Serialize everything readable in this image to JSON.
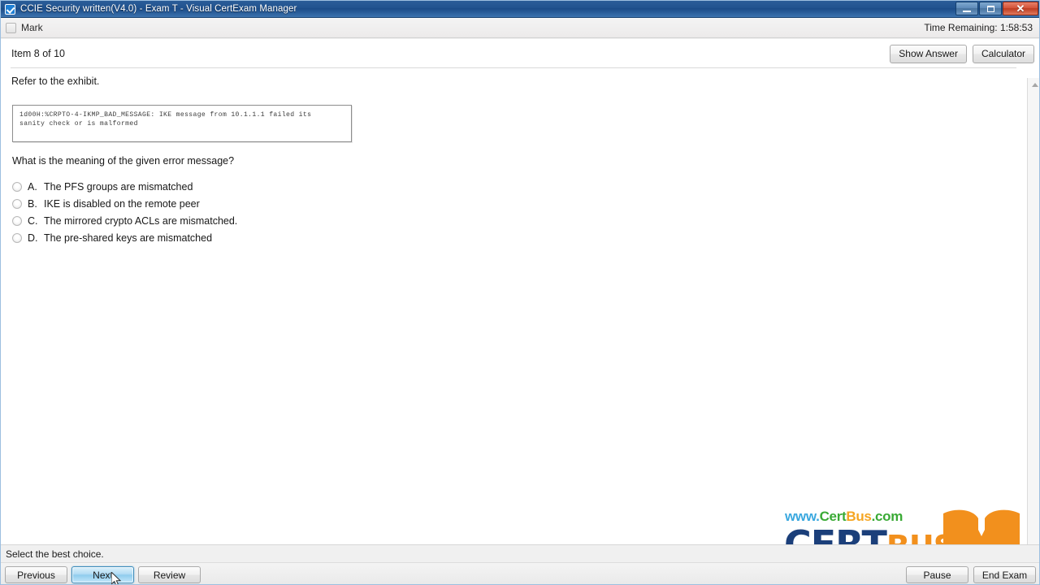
{
  "window": {
    "title": "CCIE Security written(V4.0) - Exam T - Visual CertExam Manager",
    "icon": "checkbox-app-icon",
    "minimize_label": "–",
    "maximize_label": "❐",
    "close_label": "×"
  },
  "markbar": {
    "mark_label": "Mark",
    "time_remaining": "Time Remaining: 1:58:53"
  },
  "header": {
    "item_label": "Item 8 of 10",
    "show_answer_label": "Show Answer",
    "calculator_label": "Calculator"
  },
  "question": {
    "refer_text": "Refer to the exhibit.",
    "exhibit_text": "1d00H:%CRPTO-4-IKMP_BAD_MESSAGE: IKE message from 10.1.1.1 failed its\nsanity check or is malformed",
    "prompt": "What is the meaning of the given error message?",
    "options": [
      {
        "letter": "A.",
        "text": "The PFS groups are mismatched",
        "selected": false
      },
      {
        "letter": "B.",
        "text": "IKE is disabled on the remote peer",
        "selected": false
      },
      {
        "letter": "C.",
        "text": "The mirrored crypto ACLs are mismatched.",
        "selected": false
      },
      {
        "letter": "D.",
        "text": "The pre-shared keys are mismatched",
        "selected": false
      }
    ]
  },
  "logo": {
    "url_www": "www.",
    "url_cert": "Cert",
    "url_bus": "Bus",
    "url_com": ".com",
    "word_cert": "CERT",
    "word_bus": "BUS",
    "colors": {
      "www": "#3aa8df",
      "cert": "#3aaa35",
      "bus": "#f5a623",
      "com": "#3aaa35",
      "word_cert": "#1b3f7a",
      "word_bus": "#f2901d",
      "mark": "#f2901d"
    }
  },
  "statusbar": {
    "hint": "Select the best choice."
  },
  "footer": {
    "previous_label": "Previous",
    "next_label": "Next",
    "review_label": "Review",
    "pause_label": "Pause",
    "end_exam_label": "End Exam"
  }
}
